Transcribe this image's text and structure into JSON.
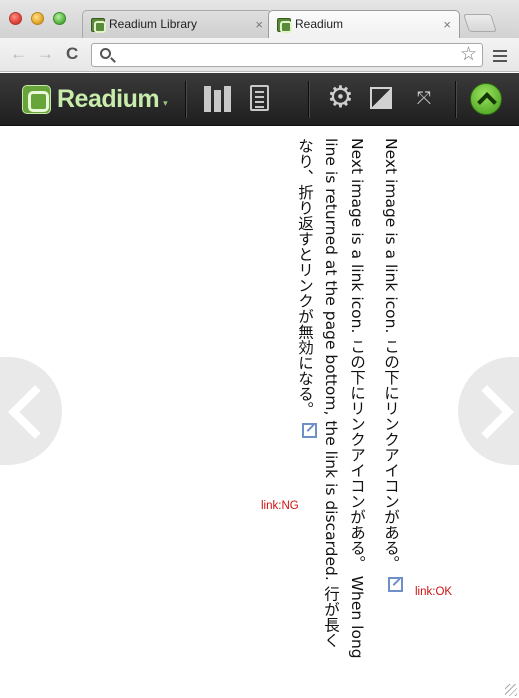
{
  "window": {
    "tabs": [
      {
        "label": "Readium Library",
        "close_glyph": "×"
      },
      {
        "label": "Readium",
        "close_glyph": "×"
      }
    ],
    "active_tab": 1
  },
  "toolbar": {
    "back_glyph": "←",
    "forward_glyph": "→",
    "reload_glyph": "C",
    "url_value": "",
    "star_glyph": "☆"
  },
  "app_bar": {
    "brand": "Readium",
    "brand_caret": "▾",
    "settings_glyph": "⚙",
    "fullscreen_glyph": "⤧",
    "accent_color": "#5cb02e"
  },
  "content": {
    "column1": {
      "text": "Next image is a link icon. この下にリンクアイコンがある。"
    },
    "column2": {
      "text": "Next image is a link icon. この下にリンクアイコンがある。 When long line is returned at the page bottom, the link is discarded. 行が長くなり、折り返すとリンクが無効になる。"
    },
    "link_ok_label": "link:OK",
    "link_ng_label": "link:NG",
    "link_label_color": "#cc1111"
  }
}
